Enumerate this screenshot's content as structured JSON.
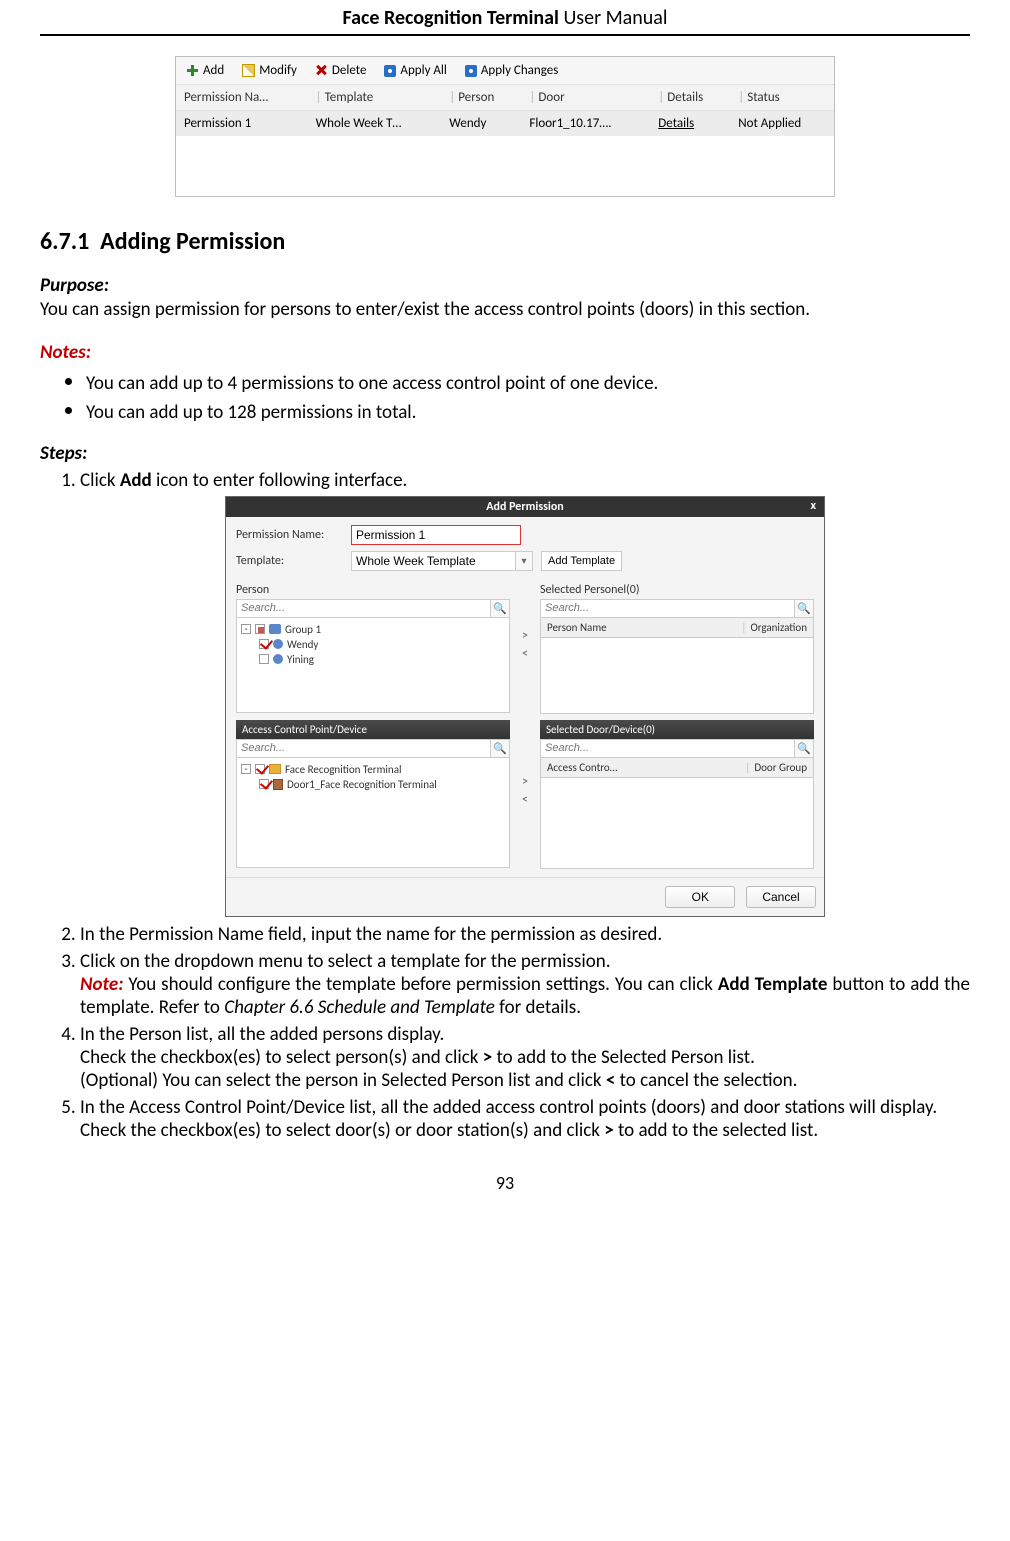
{
  "header": {
    "bold": "Face Recognition Terminal",
    "rest": "  User Manual"
  },
  "fig1": {
    "toolbar": {
      "add": "Add",
      "modify": "Modify",
      "delete": "Delete",
      "applyAll": "Apply All",
      "applyChanges": "Apply Changes"
    },
    "cols": [
      "Permission Na…",
      "Template",
      "Person",
      "Door",
      "Details",
      "Status"
    ],
    "row": [
      "Permission 1",
      "Whole Week T…",
      "Wendy",
      "Floor1_10.17….",
      "Details",
      "Not Applied"
    ]
  },
  "section": {
    "num": "6.7.1",
    "title": "Adding Permission"
  },
  "purposeLabel": "Purpose:",
  "purposeText": "You can assign permission for persons to enter/exist the access control points (doors) in this section.",
  "notesLabel": "Notes:",
  "notes": [
    "You can add up to 4 permissions to one access control point of one device.",
    "You can add up to 128 permissions in total."
  ],
  "stepsLabel": "Steps:",
  "step1": {
    "pre": "Click ",
    "bold": "Add",
    "post": " icon to enter following interface."
  },
  "fig2": {
    "title": "Add Permission",
    "close": "x",
    "permNameLabel": "Permission Name:",
    "permNameVal": "Permission 1",
    "templateLabel": "Template:",
    "templateVal": "Whole Week Template",
    "addTemplate": "Add Template",
    "personLabel": "Person",
    "selectedPersonLabel": "Selected Personel(0)",
    "searchPH": "Search...",
    "group1": "Group 1",
    "wendy": "Wendy",
    "yining": "Yining",
    "spHead": {
      "a": "Person Name",
      "b": "Organization"
    },
    "acpLabel": "Access Control Point/Device",
    "selDoorLabel": "Selected Door/Device(0)",
    "acpRoot": "Face Recognition Terminal",
    "acpDoor": "Door1_Face Recognition Terminal",
    "sdHead": {
      "a": "Access Contro…",
      "b": "Door Group"
    },
    "ok": "OK",
    "cancel": "Cancel"
  },
  "step2": "In the Permission Name field, input the name for the permission as desired.",
  "step3_line": "Click on the dropdown menu to select a template for the permission.",
  "step3_note": {
    "label": "Note:",
    "t1": " You should configure the template before permission settings. You can click ",
    "b1": "Add Template",
    "t2": " button to add the template. Refer to ",
    "i1": "Chapter 6.6 Schedule and Template",
    "t3": " for details."
  },
  "step4_l1": "In the Person list, all the added persons display.",
  "step4_l2": {
    "a": "Check the checkbox(es) to select person(s) and click ",
    "b": ">",
    "c": " to add to the Selected Person list."
  },
  "step4_l3": {
    "a": "(Optional) You can select the person in Selected Person list and click ",
    "b": "<",
    "c": " to cancel the selection."
  },
  "step5_l1": "In the Access Control Point/Device list, all the added access control points (doors) and door stations will display.",
  "step5_l2": {
    "a": "Check the checkbox(es) to select door(s) or door station(s) and click ",
    "b": ">",
    "c": " to add to the selected list."
  },
  "pagenum": "93"
}
